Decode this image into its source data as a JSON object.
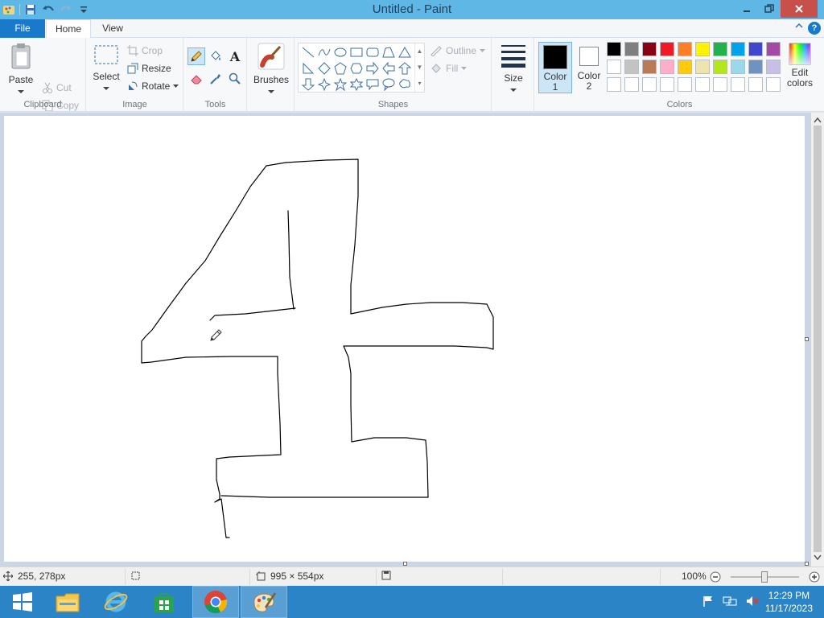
{
  "window": {
    "title": "Untitled - Paint"
  },
  "tabs": {
    "file": "File",
    "home": "Home",
    "view": "View"
  },
  "clipboard": {
    "paste": "Paste",
    "cut": "Cut",
    "copy": "Copy",
    "label": "Clipboard"
  },
  "image": {
    "select": "Select",
    "crop": "Crop",
    "resize": "Resize",
    "rotate": "Rotate",
    "label": "Image"
  },
  "tools": {
    "label": "Tools",
    "text_glyph": "A"
  },
  "brushes": {
    "label": "Brushes"
  },
  "shapes": {
    "outline": "Outline",
    "fill": "Fill",
    "label": "Shapes"
  },
  "size": {
    "label": "Size"
  },
  "colors": {
    "color1_line1": "Color",
    "color1_line2": "1",
    "color2_line1": "Color",
    "color2_line2": "2",
    "edit_line1": "Edit",
    "edit_line2": "colors",
    "label": "Colors",
    "color1_value": "#000000",
    "color2_value": "#ffffff",
    "palette": [
      "#000000",
      "#7f7f7f",
      "#880015",
      "#ed1c24",
      "#ff7f27",
      "#fff200",
      "#22b14c",
      "#00a2e8",
      "#3f48cc",
      "#a349a4",
      "#ffffff",
      "#c3c3c3",
      "#b97a57",
      "#ffaec9",
      "#ffc90e",
      "#efe4b0",
      "#b5e61d",
      "#99d9ea",
      "#7092be",
      "#c8bfe7",
      "#ffffff",
      "#ffffff",
      "#ffffff",
      "#ffffff",
      "#ffffff",
      "#ffffff",
      "#ffffff",
      "#ffffff",
      "#ffffff",
      "#ffffff"
    ]
  },
  "status": {
    "cursor_pos": "255, 278px",
    "canvas_size": "995 × 554px",
    "zoom": "100%"
  },
  "taskbar": {
    "time": "12:29 PM",
    "date": "11/17/2023"
  }
}
